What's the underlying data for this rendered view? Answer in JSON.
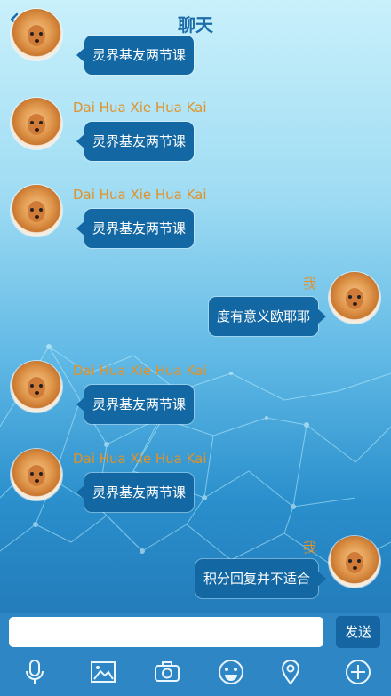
{
  "header": {
    "title": "聊天",
    "back_icon": "chevron-left-icon"
  },
  "messages": [
    {
      "side": "left",
      "name": "",
      "text": "灵界基友两节课"
    },
    {
      "side": "left",
      "name": "Dai Hua Xie Hua Kai",
      "text": "灵界基友两节课"
    },
    {
      "side": "left",
      "name": "Dai Hua Xie Hua Kai",
      "text": "灵界基友两节课"
    },
    {
      "side": "right",
      "name": "我",
      "text": "度有意义欧耶耶"
    },
    {
      "side": "left",
      "name": "Dai Hua Xie Hua Kai",
      "text": "灵界基友两节课"
    },
    {
      "side": "left",
      "name": "Dai Hua Xie Hua Kai",
      "text": "灵界基友两节课"
    },
    {
      "side": "right",
      "name": "我",
      "text": "积分回复并不适合"
    }
  ],
  "input": {
    "value": "",
    "placeholder": "",
    "send_label": "发送"
  },
  "toolbar": {
    "icons": [
      "microphone-icon",
      "image-icon",
      "camera-icon",
      "emoji-icon",
      "location-icon",
      "plus-icon"
    ]
  },
  "colors": {
    "bubble": "#1368a3",
    "name": "#e0922a",
    "title": "#1c6ca8",
    "bar": "#2f86c4"
  }
}
